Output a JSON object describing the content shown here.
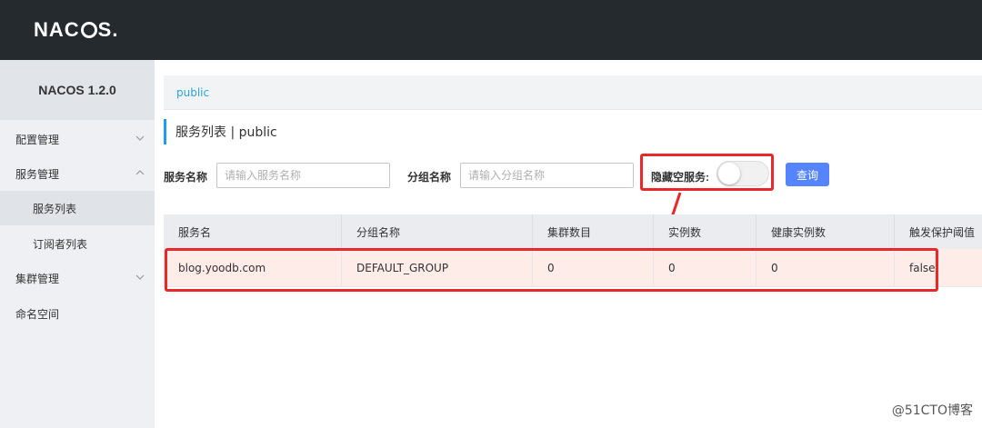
{
  "app": {
    "logo": "NACOS.",
    "version": "NACOS 1.2.0"
  },
  "sidebar": {
    "items": [
      {
        "label": "配置管理",
        "chevron": "down"
      },
      {
        "label": "服务管理",
        "chevron": "up"
      },
      {
        "label": "服务列表",
        "chevron": ""
      },
      {
        "label": "订阅者列表",
        "chevron": ""
      },
      {
        "label": "集群管理",
        "chevron": "down"
      },
      {
        "label": "命名空间",
        "chevron": ""
      }
    ]
  },
  "namespace_tab": "public",
  "page": {
    "title": "服务列表 | public"
  },
  "search": {
    "service_label": "服务名称",
    "service_placeholder": "请输入服务名称",
    "group_label": "分组名称",
    "group_placeholder": "请输入分组名称",
    "hide_empty_label": "隐藏空服务:",
    "hide_empty_on": false,
    "query_button": "查询"
  },
  "table": {
    "headers": [
      "服务名",
      "分组名称",
      "集群数目",
      "实例数",
      "健康实例数",
      "触发保护阈值"
    ],
    "rows": [
      [
        "blog.yoodb.com",
        "DEFAULT_GROUP",
        "0",
        "0",
        "0",
        "false"
      ]
    ]
  },
  "colors": {
    "topbar": "#252a2f",
    "accent": "#5584ff",
    "highlight": "#e8282b"
  },
  "watermark": "@51CTO博客"
}
